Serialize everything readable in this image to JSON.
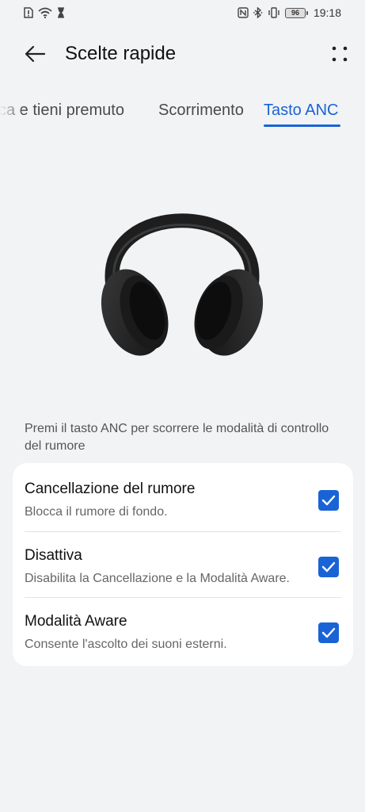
{
  "status_bar": {
    "time": "19:18",
    "battery": "96",
    "left_icons": [
      "sim-alert-icon",
      "wifi-icon",
      "hourglass-icon"
    ],
    "right_icons": [
      "nfc-icon",
      "bluetooth-icon",
      "vibrate-icon",
      "battery-icon"
    ]
  },
  "header": {
    "title": "Scelte rapide",
    "back_icon": "arrow-left-icon",
    "more_icon": "more-dots-icon"
  },
  "tabs": [
    {
      "label": "Blocca e tieni premuto",
      "visible_label": "cca e tieni premuto",
      "selected": false
    },
    {
      "label": "Scorrimento",
      "selected": false
    },
    {
      "label": "Tasto ANC",
      "selected": true
    }
  ],
  "hero_image": "headphones-image",
  "description": "Premi il tasto ANC per scorrere le modalità di controllo del rumore",
  "options": [
    {
      "title": "Cancellazione del rumore",
      "subtitle": "Blocca il rumore di fondo.",
      "checked": true
    },
    {
      "title": "Disattiva",
      "subtitle": "Disabilita la Cancellazione e la Modalità Aware.",
      "checked": true
    },
    {
      "title": "Modalità Aware",
      "subtitle": "Consente l'ascolto dei suoni esterni.",
      "checked": true
    }
  ],
  "colors": {
    "accent": "#1a63d6",
    "background": "#f1f3f5",
    "card": "#ffffff"
  }
}
